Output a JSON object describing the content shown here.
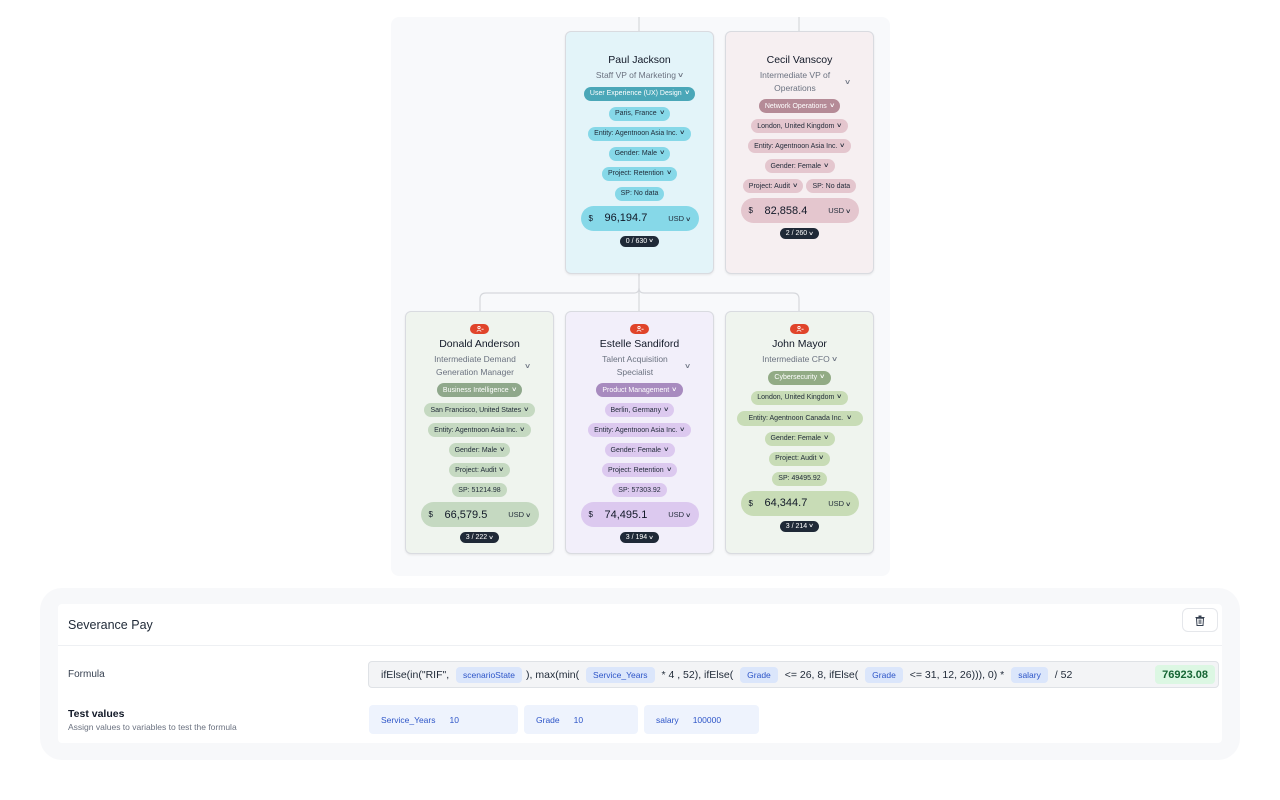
{
  "org_chart": {
    "top_row": [
      {
        "name": "Paul Jackson",
        "title": "Staff VP of Marketing",
        "theme": "cyan",
        "department": "User Experience (UX) Design",
        "location": "Paris, France",
        "entity": "Entity: Agentnoon Asia Inc.",
        "gender": "Gender: Male",
        "project": "Project: Retention",
        "sp": "SP: No data",
        "currency_symbol": "$",
        "salary": "96,194.7",
        "currency_code": "USD",
        "count": "0 / 630",
        "badge": false
      },
      {
        "name": "Cecil Vanscoy",
        "title": "Intermediate VP of Operations",
        "theme": "rose",
        "department": "Network Operations",
        "location": "London, United Kingdom",
        "entity": "Entity: Agentnoon Asia Inc.",
        "gender": "Gender: Female",
        "project": "Project: Audit",
        "sp": "SP: No data",
        "currency_symbol": "$",
        "salary": "82,858.4",
        "currency_code": "USD",
        "count": "2 / 260",
        "badge": false
      }
    ],
    "bottom_row": [
      {
        "name": "Donald Anderson",
        "title": "Intermediate Demand Generation Manager",
        "theme": "green",
        "department": "Business Intelligence",
        "location": "San Francisco, United States",
        "entity": "Entity: Agentnoon Asia Inc.",
        "gender": "Gender: Male",
        "project": "Project: Audit",
        "sp": "SP: 51214.98",
        "currency_symbol": "$",
        "salary": "66,579.5",
        "currency_code": "USD",
        "count": "3 / 222",
        "badge": true,
        "badge_icon": "user-remove-icon"
      },
      {
        "name": "Estelle Sandiford",
        "title": "Talent Acquisition Specialist",
        "theme": "purple",
        "department": "Product Management",
        "location": "Berlin, Germany",
        "entity": "Entity: Agentnoon Asia Inc.",
        "gender": "Gender: Female",
        "project": "Project: Retention",
        "sp": "SP: 57303.92",
        "currency_symbol": "$",
        "salary": "74,495.1",
        "currency_code": "USD",
        "count": "3 / 194",
        "badge": true,
        "badge_icon": "user-remove-icon"
      },
      {
        "name": "John Mayor",
        "title": "Intermediate CFO",
        "theme": "sage",
        "department": "Cybersecurity",
        "location": "London, United Kingdom",
        "entity": "Entity: Agentnoon Canada Inc.",
        "gender": "Gender: Female",
        "project": "Project: Audit",
        "sp": "SP: 49495.92",
        "currency_symbol": "$",
        "salary": "64,344.7",
        "currency_code": "USD",
        "count": "3 / 214",
        "badge": true,
        "badge_icon": "user-remove-icon"
      }
    ]
  },
  "severance": {
    "title": "Severance Pay",
    "delete_icon": "trash-icon",
    "formula_label": "Formula",
    "formula_parts": [
      {
        "type": "text",
        "value": "ifElse(in(\"RIF\", "
      },
      {
        "type": "var",
        "value": "scenarioState"
      },
      {
        "type": "text",
        "value": "), max(min( "
      },
      {
        "type": "var",
        "value": "Service_Years"
      },
      {
        "type": "text",
        "value": " * 4 , 52), ifElse( "
      },
      {
        "type": "var",
        "value": "Grade"
      },
      {
        "type": "text",
        "value": " <= 26, 8, ifElse( "
      },
      {
        "type": "var",
        "value": "Grade"
      },
      {
        "type": "text",
        "value": " <= 31, 12, 26))), 0) * "
      },
      {
        "type": "var",
        "value": "salary"
      },
      {
        "type": "text",
        "value": " / 52"
      }
    ],
    "formula_result": "76923.08",
    "test_values_title": "Test values",
    "test_values_subtitle": "Assign values to variables to test the formula",
    "test_values": [
      {
        "name": "Service_Years",
        "value": "10"
      },
      {
        "name": "Grade",
        "value": "10"
      },
      {
        "name": "salary",
        "value": "100000"
      }
    ],
    "colors": {
      "variable_chip_bg": "#dbe6fb",
      "variable_chip_text": "#2d55c8",
      "result_bg": "#dcf7e3",
      "result_text": "#166534"
    }
  }
}
